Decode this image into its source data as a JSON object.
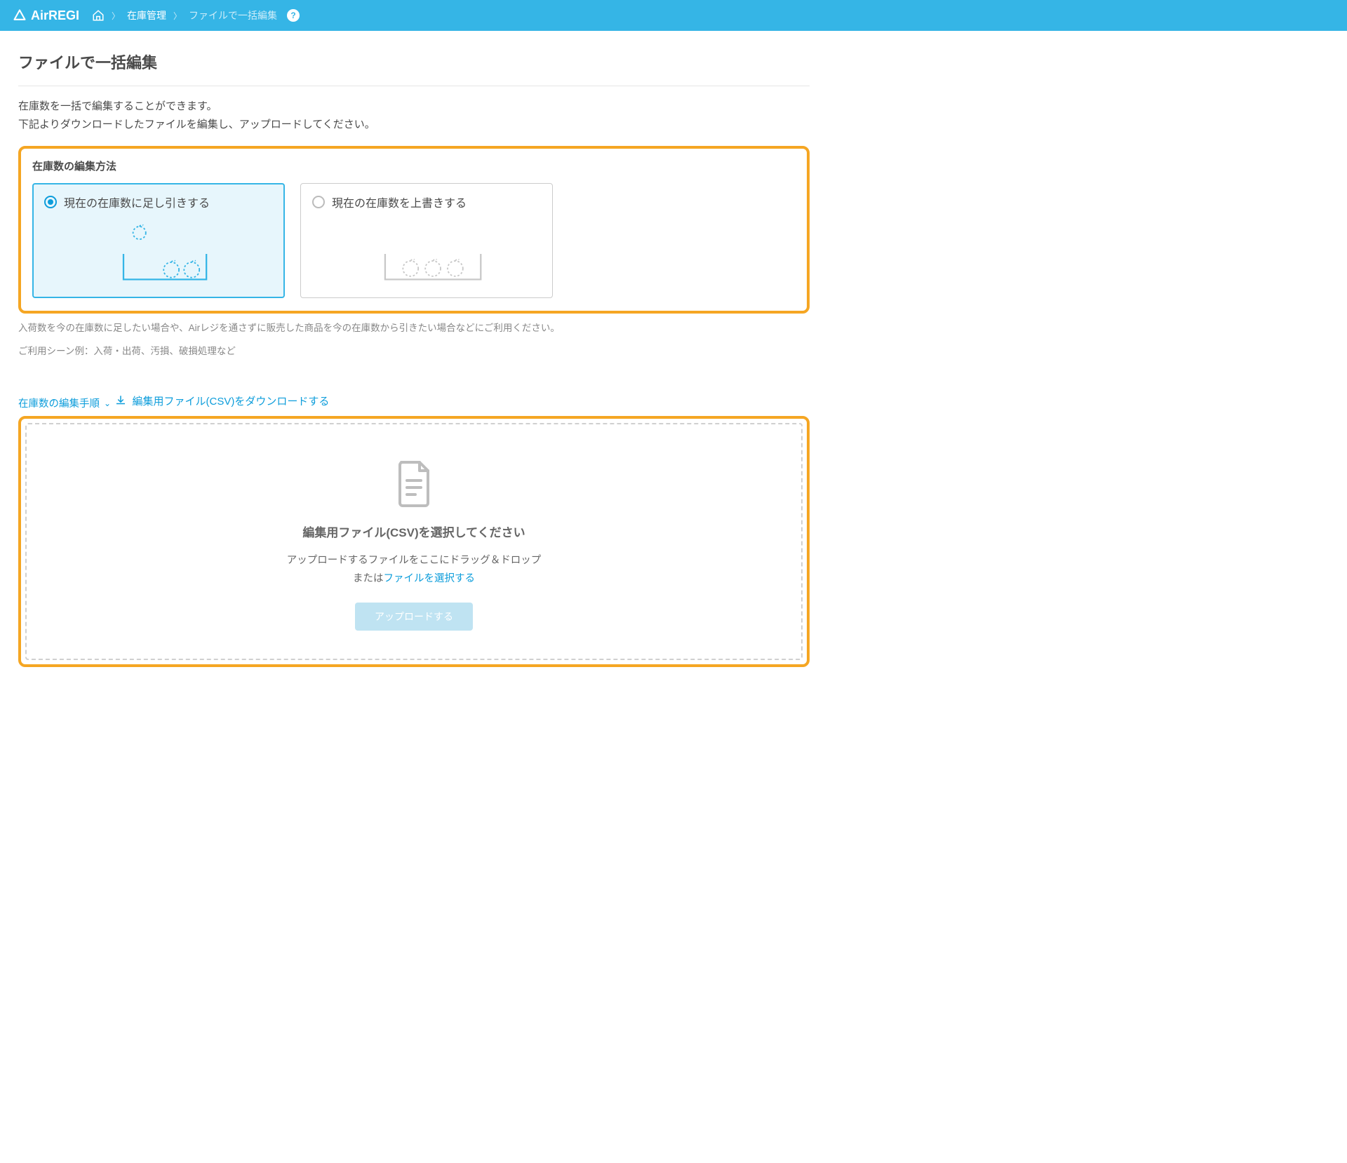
{
  "header": {
    "logo_text": "AirREGI",
    "breadcrumb": {
      "item1": "在庫管理",
      "current": "ファイルで一括編集",
      "help_symbol": "?"
    }
  },
  "page": {
    "title": "ファイルで一括編集",
    "desc_line1": "在庫数を一括で編集することができます。",
    "desc_line2": "下記よりダウンロードしたファイルを編集し、アップロードしてください。"
  },
  "edit_method": {
    "section_label": "在庫数の編集方法",
    "option_add": "現在の在庫数に足し引きする",
    "option_overwrite": "現在の在庫数を上書きする",
    "help_line1": "入荷数を今の在庫数に足したい場合や、Airレジを通さずに販売した商品を今の在庫数から引きたい場合などにご利用ください。",
    "help_line2": "ご利用シーン例：入荷・出荷、汚損、破損処理など",
    "expand_label": "在庫数の編集手順"
  },
  "download": {
    "label": "編集用ファイル(CSV)をダウンロードする"
  },
  "upload": {
    "title": "編集用ファイル(CSV)を選択してください",
    "desc_drag": "アップロードするファイルをここにドラッグ＆ドロップ",
    "desc_or": "または",
    "desc_select": "ファイルを選択する",
    "button": "アップロードする"
  }
}
